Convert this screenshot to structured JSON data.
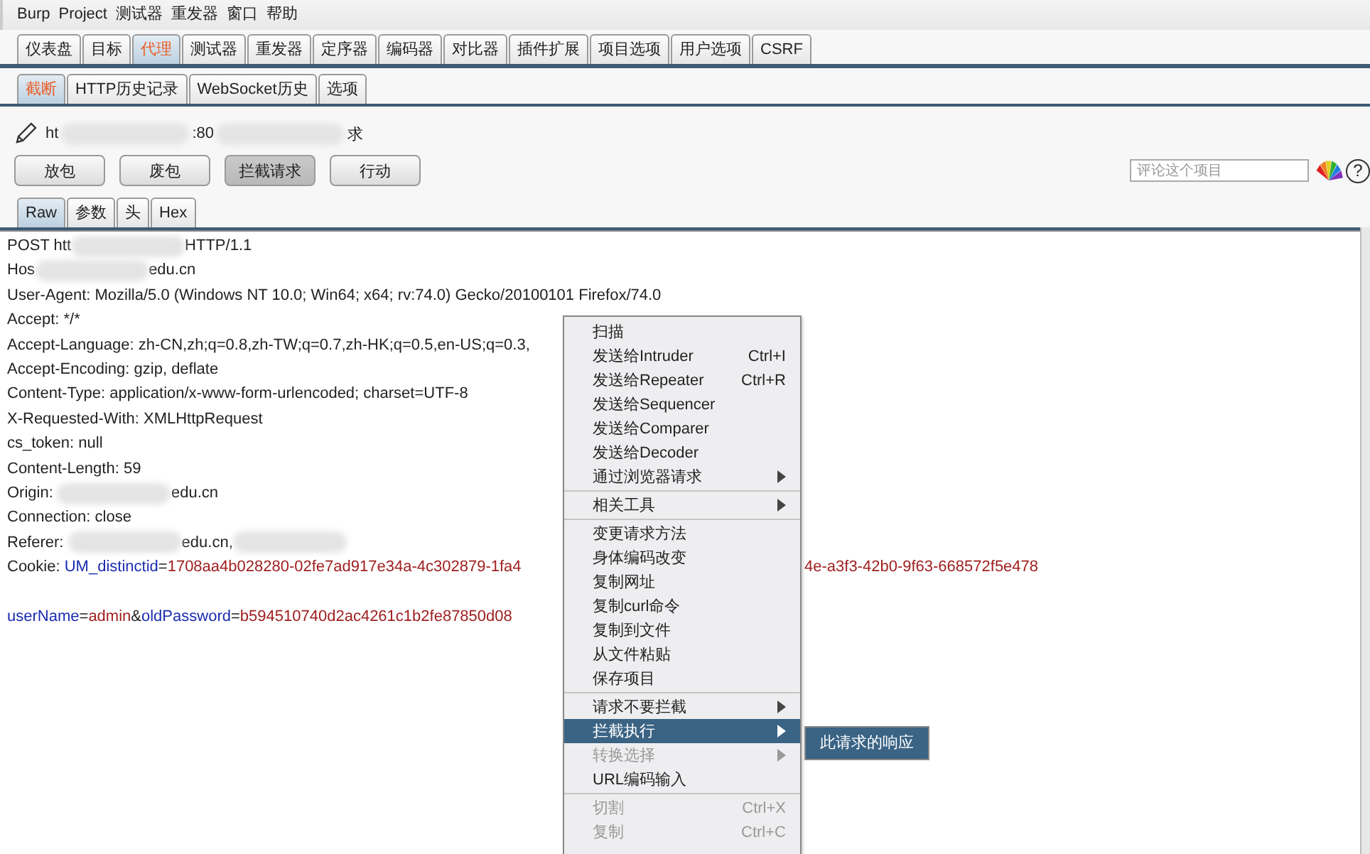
{
  "menu_bar": [
    "Burp",
    "Project",
    "测试器",
    "重发器",
    "窗口",
    "帮助"
  ],
  "main_tabs": [
    {
      "label": "仪表盘",
      "selected": false
    },
    {
      "label": "目标",
      "selected": false
    },
    {
      "label": "代理",
      "selected": true
    },
    {
      "label": "测试器",
      "selected": false
    },
    {
      "label": "重发器",
      "selected": false
    },
    {
      "label": "定序器",
      "selected": false
    },
    {
      "label": "编码器",
      "selected": false
    },
    {
      "label": "对比器",
      "selected": false
    },
    {
      "label": "插件扩展",
      "selected": false
    },
    {
      "label": "项目选项",
      "selected": false
    },
    {
      "label": "用户选项",
      "selected": false
    },
    {
      "label": "CSRF",
      "selected": false
    }
  ],
  "sub_tabs": [
    {
      "label": "截断",
      "selected": true
    },
    {
      "label": "HTTP历史记录",
      "selected": false
    },
    {
      "label": "WebSocket历史",
      "selected": false
    },
    {
      "label": "选项",
      "selected": false
    }
  ],
  "request_info": [
    {
      "kind": "text",
      "text": "ht"
    },
    {
      "kind": "redacted"
    },
    {
      "kind": "text",
      "text": ":80"
    },
    {
      "kind": "redacted"
    },
    {
      "kind": "text",
      "text": "求"
    }
  ],
  "buttons": [
    {
      "label": "放包",
      "pressed": false
    },
    {
      "label": "废包",
      "pressed": false
    },
    {
      "label": "拦截请求",
      "pressed": true
    },
    {
      "label": "行动",
      "pressed": false
    }
  ],
  "comment": {
    "placeholder": "评论这个项目"
  },
  "help": "?",
  "view_tabs": [
    {
      "label": "Raw",
      "selected": true
    },
    {
      "label": "参数",
      "selected": false
    },
    {
      "label": "头",
      "selected": false
    },
    {
      "label": "Hex",
      "selected": false
    }
  ],
  "request_lines": [
    [
      {
        "kind": "text",
        "text": "POST htt"
      },
      {
        "kind": "redacted"
      },
      {
        "kind": "text",
        "text": "HTTP/1.1"
      }
    ],
    [
      {
        "kind": "text",
        "text": "Hos"
      },
      {
        "kind": "redacted"
      },
      {
        "kind": "text",
        "text": "edu.cn"
      }
    ],
    [
      {
        "kind": "text",
        "text": "User-Agent: Mozilla/5.0 (Windows NT 10.0; Win64; x64; rv:74.0) Gecko/20100101 Firefox/74.0"
      }
    ],
    [
      {
        "kind": "text",
        "text": "Accept: */*"
      }
    ],
    [
      {
        "kind": "text",
        "text": "Accept-Language: zh-CN,zh;q=0.8,zh-TW;q=0.7,zh-HK;q=0.5,en-US;q=0.3,"
      }
    ],
    [
      {
        "kind": "text",
        "text": "Accept-Encoding: gzip, deflate"
      }
    ],
    [
      {
        "kind": "text",
        "text": "Content-Type: application/x-www-form-urlencoded; charset=UTF-8"
      }
    ],
    [
      {
        "kind": "text",
        "text": "X-Requested-With: XMLHttpRequest"
      }
    ],
    [
      {
        "kind": "text",
        "text": "cs_token: null"
      }
    ],
    [
      {
        "kind": "text",
        "text": "Content-Length: 59"
      }
    ],
    [
      {
        "kind": "text",
        "text": "Origin: "
      },
      {
        "kind": "redacted"
      },
      {
        "kind": "text",
        "text": "edu.cn"
      }
    ],
    [
      {
        "kind": "text",
        "text": "Connection: close"
      }
    ],
    [
      {
        "kind": "text",
        "text": "Referer: "
      },
      {
        "kind": "redacted"
      },
      {
        "kind": "text",
        "text": "edu.cn,"
      },
      {
        "kind": "redacted"
      }
    ],
    [
      {
        "kind": "text",
        "text": "Cookie: "
      },
      {
        "kind": "name",
        "text": "UM_distinctid"
      },
      {
        "kind": "text",
        "text": "="
      },
      {
        "kind": "value",
        "text": "1708aa4b028280-02fe7ad917e34a-4c302879-1fa4"
      },
      {
        "kind": "hidden"
      },
      {
        "kind": "value",
        "text": "4e-a3f3-42b0-9f63-668572f5e478"
      }
    ]
  ],
  "request_body": [
    [
      {
        "kind": "name",
        "text": "userName"
      },
      {
        "kind": "text",
        "text": "="
      },
      {
        "kind": "value",
        "text": "admin"
      },
      {
        "kind": "text",
        "text": "&"
      },
      {
        "kind": "name",
        "text": "oldPassword"
      },
      {
        "kind": "text",
        "text": "="
      },
      {
        "kind": "value",
        "text": "b594510740d2ac4261c1b2fe87850d08"
      }
    ]
  ],
  "context_menu": [
    {
      "kind": "item",
      "label": "扫描",
      "submenu": false,
      "disabled": false,
      "selected": false
    },
    {
      "kind": "item",
      "label": "发送给Intruder",
      "shortcut": "Ctrl+I",
      "submenu": false,
      "disabled": false,
      "selected": false
    },
    {
      "kind": "item",
      "label": "发送给Repeater",
      "shortcut": "Ctrl+R",
      "submenu": false,
      "disabled": false,
      "selected": false
    },
    {
      "kind": "item",
      "label": "发送给Sequencer",
      "submenu": false,
      "disabled": false,
      "selected": false
    },
    {
      "kind": "item",
      "label": "发送给Comparer",
      "submenu": false,
      "disabled": false,
      "selected": false
    },
    {
      "kind": "item",
      "label": "发送给Decoder",
      "submenu": false,
      "disabled": false,
      "selected": false
    },
    {
      "kind": "item",
      "label": "通过浏览器请求",
      "submenu": true,
      "disabled": false,
      "selected": false
    },
    {
      "kind": "separator"
    },
    {
      "kind": "item",
      "label": "相关工具",
      "submenu": true,
      "disabled": false,
      "selected": false
    },
    {
      "kind": "separator"
    },
    {
      "kind": "item",
      "label": "变更请求方法",
      "submenu": false,
      "disabled": false,
      "selected": false
    },
    {
      "kind": "item",
      "label": "身体编码改变",
      "submenu": false,
      "disabled": false,
      "selected": false
    },
    {
      "kind": "item",
      "label": "复制网址",
      "submenu": false,
      "disabled": false,
      "selected": false
    },
    {
      "kind": "item",
      "label": "复制curl命令",
      "submenu": false,
      "disabled": false,
      "selected": false
    },
    {
      "kind": "item",
      "label": "复制到文件",
      "submenu": false,
      "disabled": false,
      "selected": false
    },
    {
      "kind": "item",
      "label": "从文件粘贴",
      "submenu": false,
      "disabled": false,
      "selected": false
    },
    {
      "kind": "item",
      "label": "保存项目",
      "submenu": false,
      "disabled": false,
      "selected": false
    },
    {
      "kind": "separator"
    },
    {
      "kind": "item",
      "label": "请求不要拦截",
      "submenu": true,
      "disabled": false,
      "selected": false
    },
    {
      "kind": "item",
      "label": "拦截执行",
      "submenu": true,
      "disabled": false,
      "selected": true
    },
    {
      "kind": "item",
      "label": "转换选择",
      "submenu": true,
      "disabled": true,
      "selected": false
    },
    {
      "kind": "item",
      "label": "URL编码输入",
      "submenu": false,
      "disabled": false,
      "selected": false
    },
    {
      "kind": "separator"
    },
    {
      "kind": "item",
      "label": "切割",
      "shortcut": "Ctrl+X",
      "submenu": false,
      "disabled": true,
      "selected": false
    },
    {
      "kind": "item",
      "label": "复制",
      "shortcut": "Ctrl+C",
      "submenu": false,
      "disabled": true,
      "selected": false
    }
  ],
  "submenu": [
    {
      "label": "此请求的响应",
      "selected": true
    }
  ]
}
